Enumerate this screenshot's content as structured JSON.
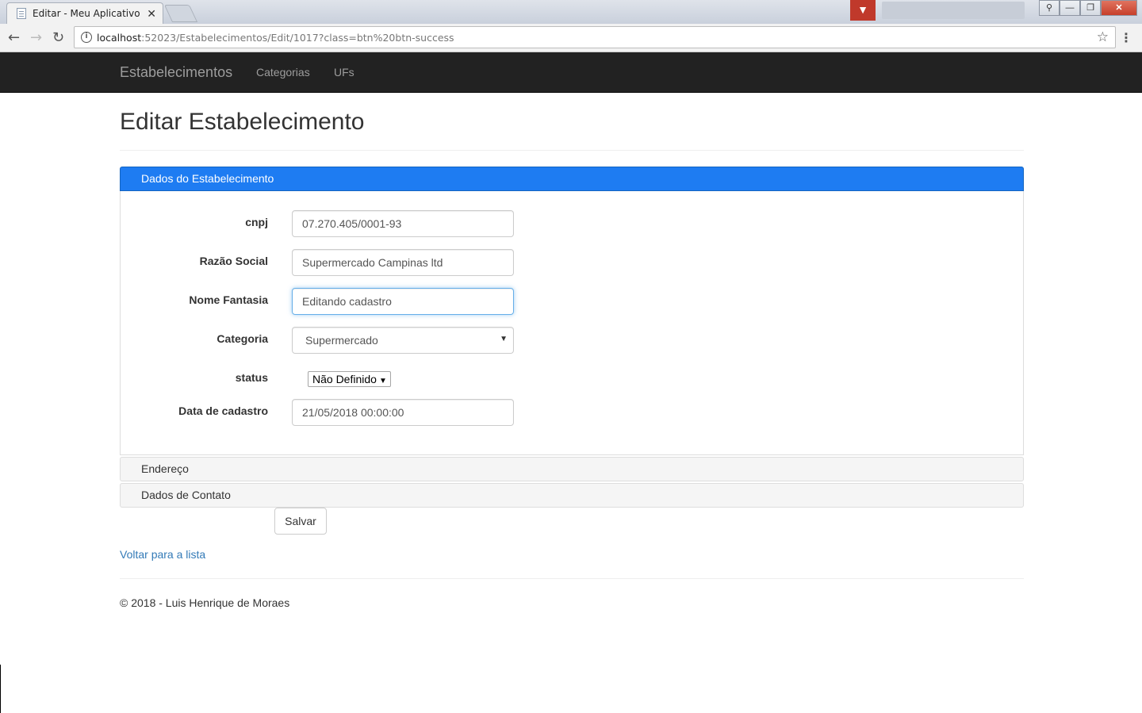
{
  "browser": {
    "tab_title": "Editar - Meu Aplicativo A",
    "url_host": "localhost",
    "url_rest": ":52023/Estabelecimentos/Edit/1017?class=btn%20btn-success"
  },
  "navbar": {
    "brand": "Estabelecimentos",
    "links": [
      "Categorias",
      "UFs"
    ]
  },
  "page": {
    "title": "Editar Estabelecimento"
  },
  "panels": {
    "dados": "Dados do Estabelecimento",
    "endereco": "Endereço",
    "contato": "Dados de Contato"
  },
  "form": {
    "cnpj": {
      "label": "cnpj",
      "value": "07.270.405/0001-93"
    },
    "razao_social": {
      "label": "Razão Social",
      "value": "Supermercado Campinas ltd"
    },
    "nome_fantasia": {
      "label": "Nome Fantasia",
      "value": "Editando cadastro"
    },
    "categoria": {
      "label": "Categoria",
      "value": "Supermercado"
    },
    "status": {
      "label": "status",
      "value": "Não Definido"
    },
    "data_cadastro": {
      "label": "Data de cadastro",
      "value": "21/05/2018 00:00:00"
    }
  },
  "actions": {
    "save": "Salvar",
    "back": "Voltar para a lista"
  },
  "footer": {
    "text": "© 2018 - Luis Henrique de Moraes"
  },
  "colors": {
    "navbar_bg": "#222222",
    "panel_active": "#1e7cf2",
    "link": "#337ab7"
  }
}
